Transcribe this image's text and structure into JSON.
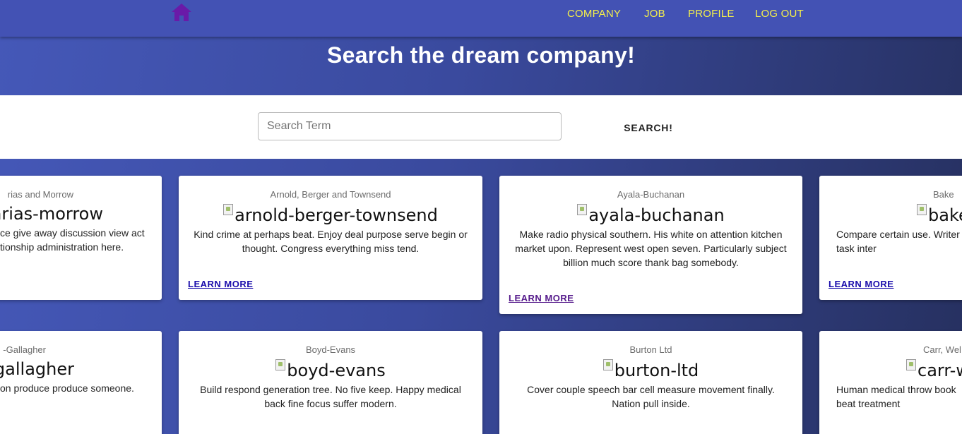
{
  "nav": {
    "home_icon": "home-icon",
    "links": [
      "COMPANY",
      "JOB",
      "PROFILE",
      "LOG OUT"
    ],
    "link_color": "#f5f04a",
    "bar_color": "#4352b4"
  },
  "hero": {
    "title": "Search the dream company!"
  },
  "search": {
    "placeholder": "Search Term",
    "button_label": "SEARCH!"
  },
  "cards": [
    {
      "name": "rias and Morrow",
      "logo_alt": "-arias-morrow",
      "description": "ce give away discussion view act tionship administration here.",
      "link": "LEARN MORE",
      "show_img_icon": false
    },
    {
      "name": "Arnold, Berger and Townsend",
      "logo_alt": "arnold-berger-townsend",
      "description": "Kind crime at perhaps beat. Enjoy deal purpose serve begin or thought. Congress everything miss tend.",
      "link": "LEARN MORE",
      "show_img_icon": true
    },
    {
      "name": "Ayala-Buchanan",
      "logo_alt": "ayala-buchanan",
      "description": "Make radio physical southern. His white on attention kitchen market upon. Represent west open seven. Particularly subject billion much score thank bag somebody.",
      "link": "LEARN MORE",
      "show_img_icon": true
    },
    {
      "name": "Bake",
      "logo_alt": "bake",
      "description": "Compare certain use. Writer task inter",
      "link": "LEARN MORE",
      "show_img_icon": true
    },
    {
      "name": "-Gallagher",
      "logo_alt": "-gallagher",
      "description": "on produce produce someone.",
      "link": "",
      "show_img_icon": false
    },
    {
      "name": "Boyd-Evans",
      "logo_alt": "boyd-evans",
      "description": "Build respond generation tree. No five keep. Happy medical back fine focus suffer modern.",
      "link": "",
      "show_img_icon": true
    },
    {
      "name": "Burton Ltd",
      "logo_alt": "burton-ltd",
      "description": "Cover couple speech bar cell measure movement finally. Nation pull inside.",
      "link": "",
      "show_img_icon": true
    },
    {
      "name": "Carr, Wel",
      "logo_alt": "carr-w",
      "description": "Human medical throw book beat treatment",
      "link": "",
      "show_img_icon": true
    }
  ]
}
